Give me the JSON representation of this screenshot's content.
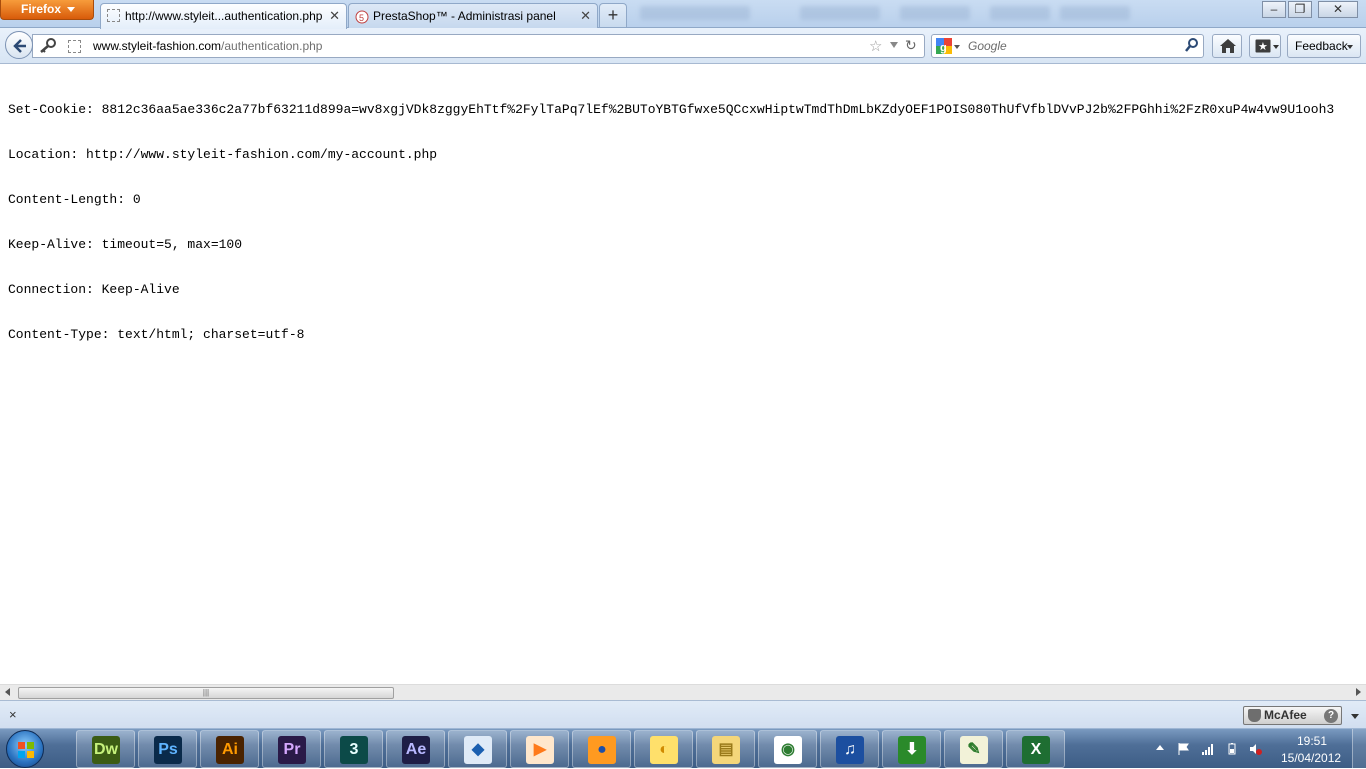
{
  "browser": {
    "menu_button": "Firefox",
    "tabs": [
      {
        "title": "http://www.styleit...authentication.php",
        "active": true
      },
      {
        "title": "PrestaShop™ - Administrasi panel",
        "active": false
      }
    ],
    "new_tab": "+",
    "url": {
      "host": "www.styleit-fashion.com",
      "path": "/authentication.php"
    },
    "search": {
      "engine": "google-icon",
      "placeholder": "Google"
    },
    "feedback_label": "Feedback"
  },
  "content": {
    "headers": [
      "Set-Cookie: 8812c36aa5ae336c2a77bf63211d899a=wv8xgjVDk8zggyEhTtf%2FylTaPq7lEf%2BUToYBTGfwxe5QCcxwHiptwTmdThDmLbKZdyOEF1POIS080ThUfVfblDVvPJ2b%2FPGhhi%2FzR0xuP4w4vw9U1ooh3",
      "Location: http://www.styleit-fashion.com/my-account.php",
      "Content-Length: 0",
      "Keep-Alive: timeout=5, max=100",
      "Connection: Keep-Alive",
      "Content-Type: text/html; charset=utf-8"
    ]
  },
  "addon_bar": {
    "close": "×",
    "mcafee_label": "McAfee",
    "mcafee_help": "?"
  },
  "taskbar": {
    "apps": [
      {
        "name": "dreamweaver",
        "label": "Dw",
        "bg": "#3b5c14",
        "fg": "#c6f27c"
      },
      {
        "name": "photoshop",
        "label": "Ps",
        "bg": "#0a2a4a",
        "fg": "#5fb4ff"
      },
      {
        "name": "illustrator",
        "label": "Ai",
        "bg": "#4a2300",
        "fg": "#ff9a00"
      },
      {
        "name": "premiere",
        "label": "Pr",
        "bg": "#2a1a48",
        "fg": "#d6a8ff"
      },
      {
        "name": "3dsmax",
        "label": "3",
        "bg": "#0c4a48",
        "fg": "#e8ffff"
      },
      {
        "name": "after-effects",
        "label": "Ae",
        "bg": "#1e1e46",
        "fg": "#b8b8ff"
      },
      {
        "name": "virtualbox",
        "label": "◆",
        "bg": "#dfeaf7",
        "fg": "#1b5fb0"
      },
      {
        "name": "media-player",
        "label": "▶",
        "bg": "#ffe7cc",
        "fg": "#ff7a1a"
      },
      {
        "name": "firefox",
        "label": "●",
        "bg": "#ff9a20",
        "fg": "#1e4fa8"
      },
      {
        "name": "app-yellow",
        "label": "◐",
        "bg": "#ffe06b",
        "fg": "#d08a00"
      },
      {
        "name": "explorer",
        "label": "▤",
        "bg": "#f4d67a",
        "fg": "#9a7a1a"
      },
      {
        "name": "chrome",
        "label": "◉",
        "bg": "#ffffff",
        "fg": "#2e7d32"
      },
      {
        "name": "itunes",
        "label": "♫",
        "bg": "#1c4fa0",
        "fg": "#ffffff"
      },
      {
        "name": "download-manager",
        "label": "⬇",
        "bg": "#2a8a2a",
        "fg": "#ffffff"
      },
      {
        "name": "notepad",
        "label": "✎",
        "bg": "#f2f2d8",
        "fg": "#2a7a2a"
      },
      {
        "name": "excel",
        "label": "X",
        "bg": "#1e6e32",
        "fg": "#ffffff"
      }
    ],
    "clock": {
      "time": "19:51",
      "date": "15/04/2012"
    }
  }
}
